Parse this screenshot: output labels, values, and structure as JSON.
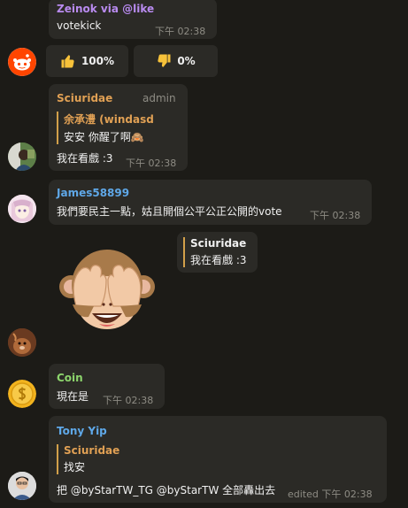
{
  "colors": {
    "background": "#1c1b17",
    "bubble": "#2b2a26",
    "name_purple": "#b98bf0",
    "name_orange": "#e0a054",
    "name_blue": "#5fa8e8",
    "name_green": "#8cd46c",
    "reply_bar": "#d2a04a"
  },
  "messages": [
    {
      "sender": "Zeinok via @like",
      "text": "votekick",
      "time": "下午 02:38",
      "buttons": [
        {
          "icon": "thumbs-up-icon",
          "label": "100%"
        },
        {
          "icon": "thumbs-down-icon",
          "label": "0%"
        }
      ]
    },
    {
      "sender": "Sciuridae",
      "badge": "admin",
      "reply": {
        "name": "余承澧 (windasd",
        "text": "安安 你醒了啊🙈"
      },
      "text": "我在看戲 :3",
      "time": "下午 02:38"
    },
    {
      "sender": "James58899",
      "text": "我們要民主一點，姑且開個公平公正公開的vote",
      "time": "下午 02:38"
    },
    {
      "reply": {
        "name": "Sciuridae",
        "text": "我在看戲 :3"
      },
      "sticker": "see-no-evil-monkey"
    },
    {
      "sender": "Coin",
      "text": "現在是",
      "time": "下午 02:38"
    },
    {
      "sender": "Tony Yip",
      "reply": {
        "name": "Sciuridae",
        "text": "找安"
      },
      "text": "把 @byStarTW_TG @byStarTW 全部轟出去",
      "time": "edited 下午 02:38"
    }
  ]
}
